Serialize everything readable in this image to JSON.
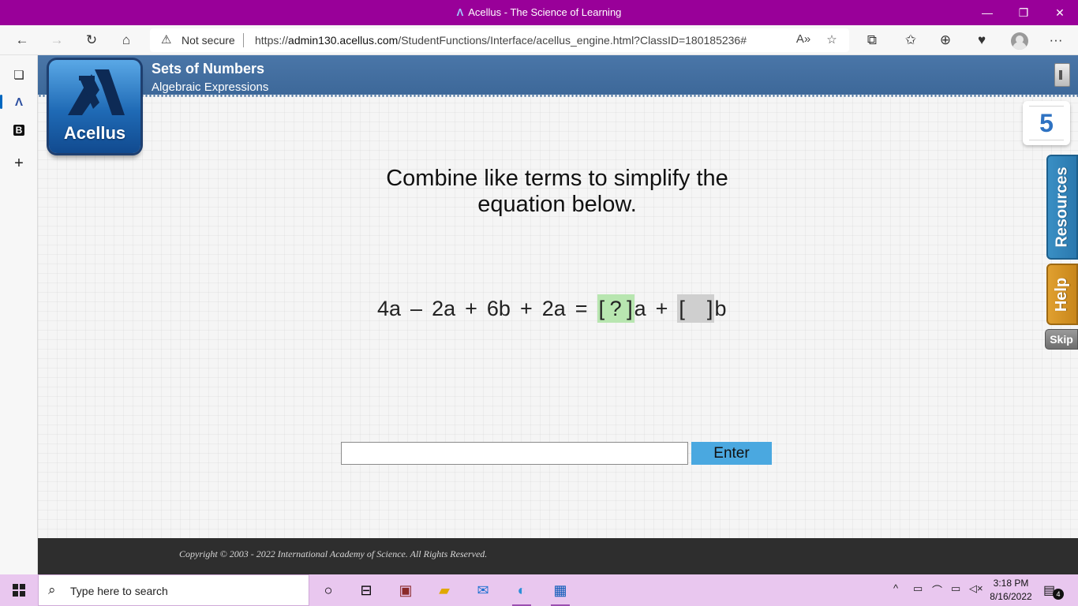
{
  "window": {
    "title": "Acellus - The Science of Learning",
    "app_icon": "acellus-icon"
  },
  "browser": {
    "security_label": "Not secure",
    "url_prefix": "https://",
    "url_host": "admin130.acellus.com",
    "url_path": "/StudentFunctions/Interface/acellus_engine.html?ClassID=180185236#"
  },
  "course": {
    "title": "Sets of Numbers",
    "subtitle": "Algebraic Expressions",
    "logo_text": "Acellus"
  },
  "counter": "5",
  "side_tabs": {
    "resources": "Resources",
    "help": "Help",
    "skip": "Skip"
  },
  "question": {
    "line1": "Combine like terms to simplify the",
    "line2": "equation below."
  },
  "equation": {
    "t1": "4a",
    "op1": "–",
    "t2": "2a",
    "op2": "+",
    "t3": "6b",
    "op3": "+",
    "t4": "2a",
    "eq": "=",
    "open1": "[",
    "blank1": "?",
    "close1": "]",
    "var1": "a",
    "op4": "+",
    "open2": "[",
    "blank2": "",
    "close2": "]",
    "var2": "b"
  },
  "answer": {
    "value": "",
    "enter_label": "Enter"
  },
  "footer": {
    "copyright": "Copyright © 2003 - 2022 International Academy of Science.  All Rights Reserved."
  },
  "taskbar": {
    "search_placeholder": "Type here to search",
    "time": "3:18 PM",
    "date": "8/16/2022",
    "notification_count": "4"
  },
  "colors": {
    "titlebar": "#990099",
    "banner": "#4a76a8",
    "resources_tab": "#2a78ae",
    "help_tab": "#c8861a",
    "enter_button": "#4aa8e0",
    "active_blank": "#b8e6b0",
    "taskbar": "#e9c7ef"
  }
}
